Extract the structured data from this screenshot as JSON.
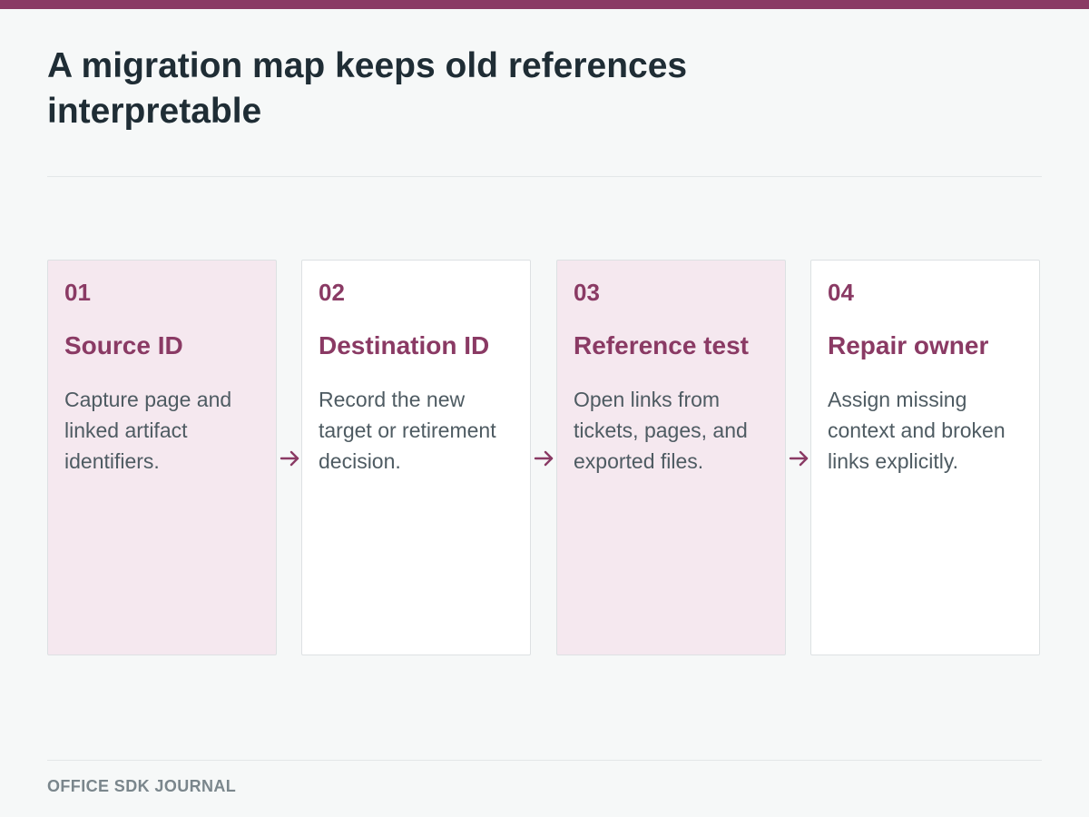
{
  "title": "A migration map keeps old references interpretable",
  "steps": [
    {
      "number": "01",
      "title": "Source ID",
      "description": "Capture page and linked artifact identifiers."
    },
    {
      "number": "02",
      "title": "Destination ID",
      "description": "Record the new target or retirement decision."
    },
    {
      "number": "03",
      "title": "Reference test",
      "description": "Open links from tickets, pages, and exported files."
    },
    {
      "number": "04",
      "title": "Repair owner",
      "description": "Assign missing context and broken links explicitly."
    }
  ],
  "footer": {
    "label": "OFFICE SDK JOURNAL"
  },
  "colors": {
    "accent": "#8a3a64",
    "tinted_card": "#f5e8ef",
    "plain_card": "#ffffff",
    "background": "#f6f8f8",
    "title_text": "#1f2d35",
    "body_text": "#4e5b62"
  },
  "icons": {
    "connector": "arrow-right-icon"
  }
}
